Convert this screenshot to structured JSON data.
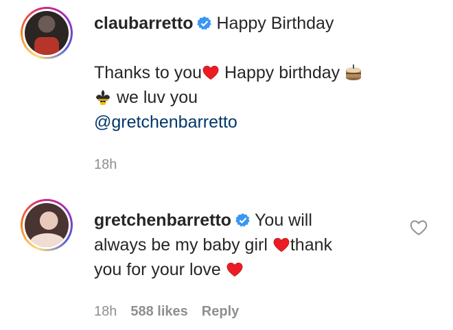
{
  "comments": [
    {
      "username": "claubarretto",
      "first_line": "Happy Birthday",
      "body_line1_a": "Thanks to you",
      "body_line1_b": "Happy birthday",
      "body_line2": "we luv you",
      "body_line3": "@gretchenbarretto",
      "time": "18h"
    },
    {
      "username": "gretchenbarretto",
      "first_line": "You will",
      "line2_a": "always be my baby girl",
      "line2_b": "thank",
      "line3": "you for your love",
      "time": "18h",
      "likes": "588 likes",
      "reply": "Reply"
    }
  ],
  "colors": {
    "verified": "#3897f0",
    "heart": "#ed4956",
    "mention": "#00376b",
    "meta": "#8e8e8e"
  }
}
